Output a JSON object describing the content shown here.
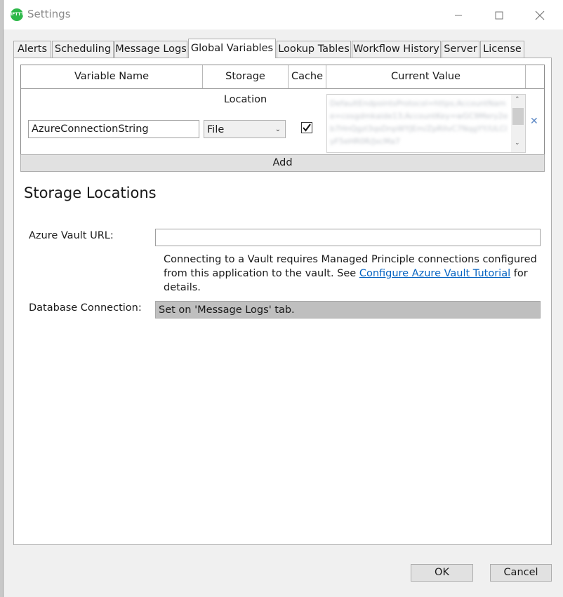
{
  "window": {
    "title": "Settings",
    "icon_label": "IFTTT"
  },
  "tabs": [
    {
      "label": "Alerts",
      "active": false
    },
    {
      "label": "Scheduling",
      "active": false
    },
    {
      "label": "Message Logs",
      "active": false
    },
    {
      "label": "Global Variables",
      "active": true
    },
    {
      "label": "Lookup Tables",
      "active": false
    },
    {
      "label": "Workflow History",
      "active": false
    },
    {
      "label": "Server",
      "active": false
    },
    {
      "label": "License",
      "active": false
    }
  ],
  "grid": {
    "headers": {
      "name": "Variable Name",
      "storage": "Storage Location",
      "cache": "Cache",
      "value": "Current Value"
    },
    "rows": [
      {
        "name": "AzureConnectionString",
        "storage": "File",
        "cache": true,
        "value": "DefaultEndpointsProtocol=https;AccountName=cosgdmkaide13;AccountKey=wGC9Mery2eb7HnQgzl3qsDnpWYJEm/ZpRIIvC7NqgYY/ULCIyF5eHR0R/JxcMa7"
      }
    ],
    "add_label": "Add"
  },
  "storage": {
    "title": "Storage Locations",
    "vault_label": "Azure Vault URL:",
    "vault_value": "",
    "info_prefix": "Connecting to a Vault requires Managed Principle connections configured from this application to the vault. See ",
    "info_link": "Configure Azure Vault Tutorial",
    "info_suffix": " for details.",
    "db_label": "Database Connection:",
    "db_value": "Set on 'Message Logs' tab."
  },
  "buttons": {
    "ok": "OK",
    "cancel": "Cancel"
  },
  "colors": {
    "accent_link": "#0563c1",
    "remove_icon": "#5a86c4",
    "app_icon": "#2eb84a"
  }
}
